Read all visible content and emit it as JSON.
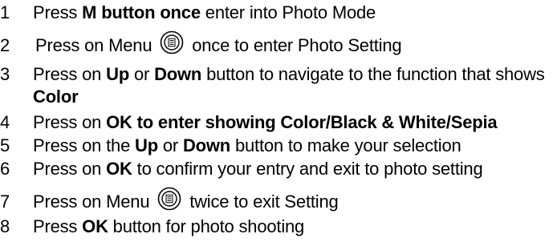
{
  "steps": [
    {
      "num": "1",
      "parts": [
        {
          "t": "Press "
        },
        {
          "t": "M button once",
          "b": true
        },
        {
          "t": " enter into Photo Mode"
        }
      ]
    },
    {
      "num": "2",
      "parts": [
        {
          "t": "Press on Menu "
        },
        {
          "icon": "menu-button-icon"
        },
        {
          "t": " once to enter Photo Setting"
        }
      ]
    },
    {
      "num": "3",
      "parts": [
        {
          "t": "Press on "
        },
        {
          "t": "Up",
          "b": true
        },
        {
          "t": " or "
        },
        {
          "t": "Down",
          "b": true
        },
        {
          "t": " button to navigate to the function that shows"
        }
      ],
      "continuation": [
        {
          "t": "Color",
          "b": true
        }
      ]
    },
    {
      "num": "4",
      "parts": [
        {
          "t": "Press on "
        },
        {
          "t": "OK to enter showing Color/Black & White/Sepia",
          "b": true
        }
      ]
    },
    {
      "num": "5",
      "parts": [
        {
          "t": "Press on the "
        },
        {
          "t": "Up",
          "b": true
        },
        {
          "t": " or "
        },
        {
          "t": "Down",
          "b": true
        },
        {
          "t": " button to make your selection"
        }
      ]
    },
    {
      "num": "6",
      "parts": [
        {
          "t": "Press on "
        },
        {
          "t": "OK",
          "b": true
        },
        {
          "t": " to confirm your entry and exit to photo setting"
        }
      ]
    },
    {
      "num": "7",
      "parts": [
        {
          "t": "Press on Menu "
        },
        {
          "icon": "menu-button-icon"
        },
        {
          "t": " twice to exit Setting"
        }
      ]
    },
    {
      "num": "8",
      "parts": [
        {
          "t": "Press "
        },
        {
          "t": "OK",
          "b": true
        },
        {
          "t": " button for photo shooting"
        }
      ]
    }
  ]
}
